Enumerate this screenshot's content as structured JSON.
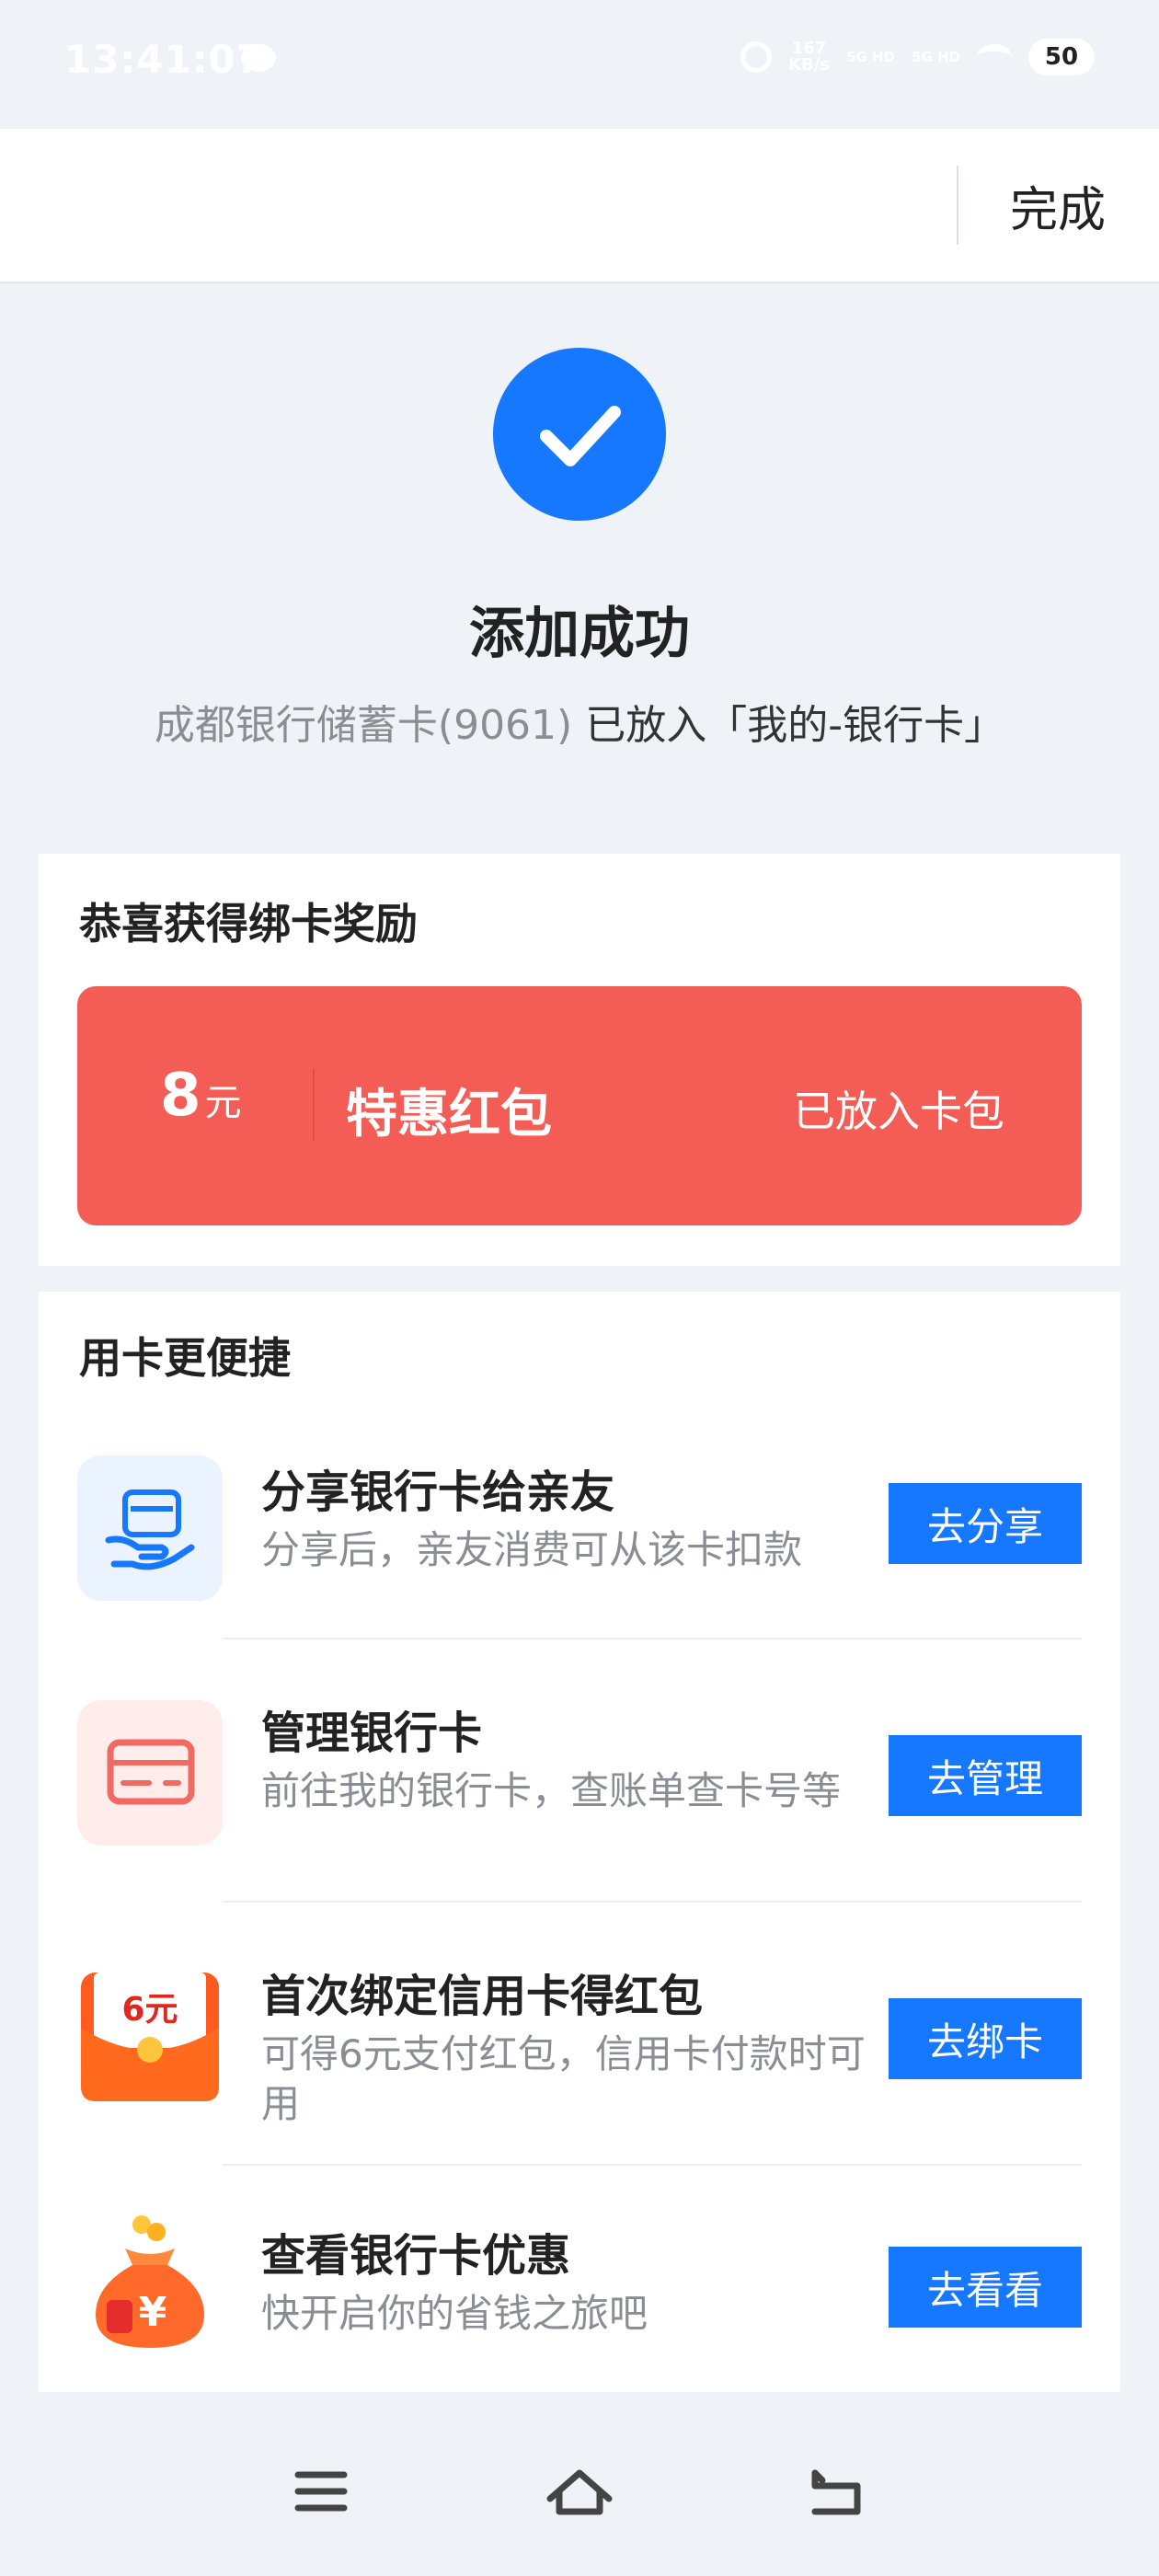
{
  "status_bar": {
    "time": "13:41:07",
    "net_speed_value": "167",
    "net_speed_unit": "KB/s",
    "signal_1": "5G HD",
    "signal_2": "5G HD",
    "battery": "50"
  },
  "header": {
    "done_label": "完成"
  },
  "success": {
    "title": "添加成功",
    "bank_card": "成都银行储蓄卡(9061)",
    "placed_text": " 已放入「我的-银行卡」"
  },
  "reward": {
    "title": "恭喜获得绑卡奖励",
    "amount": "8",
    "unit": "元",
    "name": "特惠红包",
    "status": "已放入卡包"
  },
  "convenience": {
    "title": "用卡更便捷",
    "items": [
      {
        "icon": "share-card-icon",
        "title": "分享银行卡给亲友",
        "subtitle": "分享后，亲友消费可从该卡扣款",
        "button": "去分享"
      },
      {
        "icon": "manage-card-icon",
        "title": "管理银行卡",
        "subtitle": "前往我的银行卡，查账单查卡号等",
        "button": "去管理"
      },
      {
        "icon": "red-packet-icon",
        "badge": "6元",
        "title": "首次绑定信用卡得红包",
        "subtitle": "可得6元支付红包，信用卡付款时可用",
        "button": "去绑卡"
      },
      {
        "icon": "money-bag-icon",
        "title": "查看银行卡优惠",
        "subtitle": "快开启你的省钱之旅吧",
        "button": "去看看"
      }
    ]
  },
  "colors": {
    "accent": "#1677ff",
    "reward_red": "#f45d55",
    "background": "#eff2f6"
  }
}
